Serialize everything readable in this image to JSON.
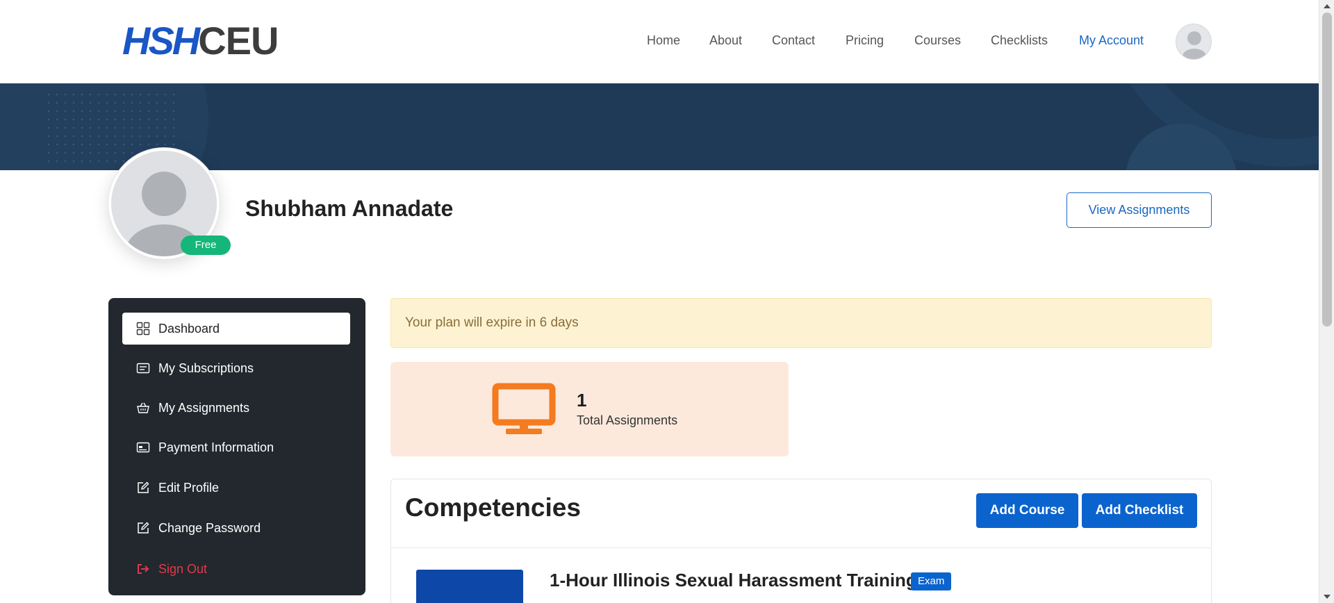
{
  "header": {
    "logo_part1": "HSH",
    "logo_part2": "CEU",
    "nav": [
      {
        "label": "Home"
      },
      {
        "label": "About"
      },
      {
        "label": "Contact"
      },
      {
        "label": "Pricing"
      },
      {
        "label": "Courses"
      },
      {
        "label": "Checklists"
      },
      {
        "label": "My Account",
        "active": true
      }
    ]
  },
  "profile": {
    "name": "Shubham Annadate",
    "plan_badge": "Free",
    "view_assignments_label": "View Assignments"
  },
  "sidebar": {
    "items": [
      {
        "label": "Dashboard",
        "icon": "dashboard-icon",
        "active": true
      },
      {
        "label": "My Subscriptions",
        "icon": "subscriptions-icon"
      },
      {
        "label": "My Assignments",
        "icon": "basket-icon"
      },
      {
        "label": "Payment Information",
        "icon": "payment-card-icon"
      },
      {
        "label": "Edit Profile",
        "icon": "edit-icon"
      },
      {
        "label": "Change Password",
        "icon": "edit-icon"
      },
      {
        "label": "Sign Out",
        "icon": "sign-out-icon"
      }
    ]
  },
  "alert": {
    "text": "Your plan will expire in 6 days"
  },
  "stat": {
    "value": "1",
    "label": "Total Assignments",
    "icon": "monitor-icon"
  },
  "competencies": {
    "title": "Competencies",
    "add_course_label": "Add Course",
    "add_checklist_label": "Add Checklist",
    "course_title": "1-Hour Illinois Sexual Harassment Training",
    "course_tag": "Exam"
  },
  "colors": {
    "brand_blue": "#1a66c4",
    "banner": "#1f3a57",
    "success": "#14b67a",
    "danger": "#e03a4a",
    "accent_orange": "#f47b20"
  }
}
